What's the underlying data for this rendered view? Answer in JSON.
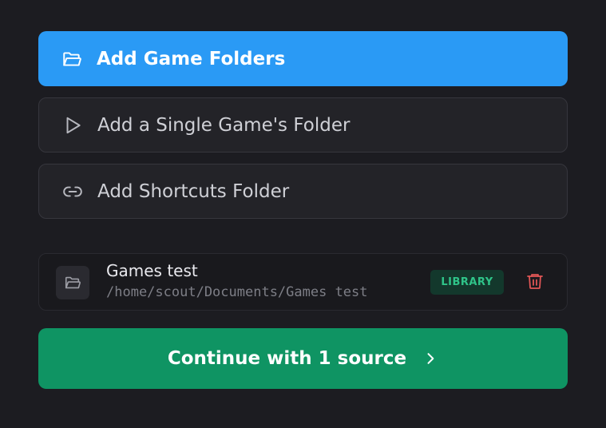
{
  "actions": {
    "add_game_folders": {
      "label": "Add Game Folders",
      "icon": "folder-open-icon"
    },
    "add_single_game_folder": {
      "label": "Add a Single Game's Folder",
      "icon": "play-icon"
    },
    "add_shortcuts_folder": {
      "label": "Add Shortcuts Folder",
      "icon": "link-icon"
    }
  },
  "sources": [
    {
      "name": "Games test",
      "path": "/home/scout/Documents/Games test",
      "type_badge": "LIBRARY",
      "icon": "folder-icon",
      "delete_icon": "trash-icon"
    }
  ],
  "continue_button": {
    "label": "Continue with 1 source",
    "icon": "chevron-right-icon"
  },
  "colors": {
    "background": "#1c1c21",
    "primary": "#2a9af5",
    "success": "#0f9463",
    "badge_bg": "#13382c",
    "badge_text": "#2fc489",
    "danger": "#e05555"
  }
}
